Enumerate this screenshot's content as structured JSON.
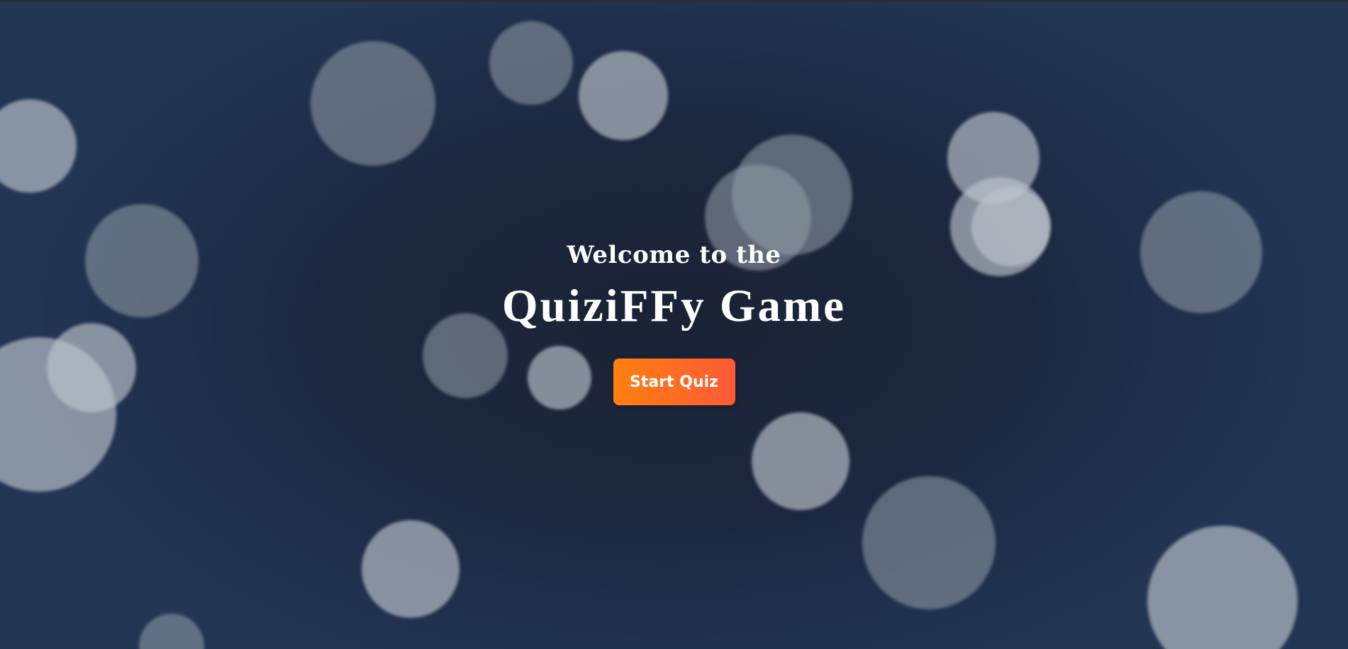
{
  "hero": {
    "welcome": "Welcome to the",
    "title": "QuiziFFy Game",
    "start_label": "Start Quiz"
  },
  "colors": {
    "background": "#1c2840",
    "button_start": "#ff7f0f",
    "button_end": "#ff5a36",
    "text": "#ffffff"
  }
}
